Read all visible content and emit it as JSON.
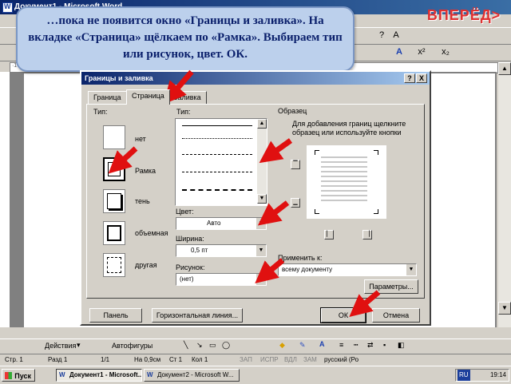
{
  "window": {
    "title": "Документ1 - Microsoft Word"
  },
  "callout": {
    "text": "…пока не появится окно «Границы и заливка». На вкладке «Страница» щёлкаем по «Рамка». Выбираем тип или рисунок, цвет. ОК."
  },
  "nav": {
    "forward": "ВПЕРЁД>"
  },
  "dialog": {
    "title": "Границы и заливка",
    "help": "?",
    "close": "X",
    "tabs": [
      "Граница",
      "Страница",
      "Заливка"
    ],
    "setting_label": "Тип:",
    "settings": [
      "нет",
      "Рамка",
      "тень",
      "объемная",
      "другая"
    ],
    "style_label": "Тип:",
    "color_label": "Цвет:",
    "color_value": "Авто",
    "width_label": "Ширина:",
    "width_value": "0,5 пт",
    "art_label": "Рисунок:",
    "art_value": "(нет)",
    "preview_label": "Образец",
    "preview_hint": "Для добавления границ щелкните образец или используйте кнопки",
    "apply_label": "Применить к:",
    "apply_value": "всему документу",
    "options_button": "Параметры...",
    "toolbar_button": "Панель",
    "hline_button": "Горизонтальная линия...",
    "ok": "ОК",
    "cancel": "Отмена"
  },
  "statusbar": {
    "page": "Стр. 1",
    "section": "Разд 1",
    "pages": "1/1",
    "at": "На 0,9см",
    "line": "Ст 1",
    "col": "Кол 1",
    "rec": "ЗАП",
    "trk": "ИСПР",
    "ext": "ВДЛ",
    "ovr": "ЗАМ",
    "lang": "русский (Ро"
  },
  "drawbar": {
    "actions": "Действия",
    "autoshapes": "Автофигуры"
  },
  "taskbar": {
    "start": "Пуск",
    "task1": "Документ1 - Microsoft...",
    "task2": "Документ2 - Microsoft W...",
    "lang": "RU",
    "clock": "19:14"
  }
}
